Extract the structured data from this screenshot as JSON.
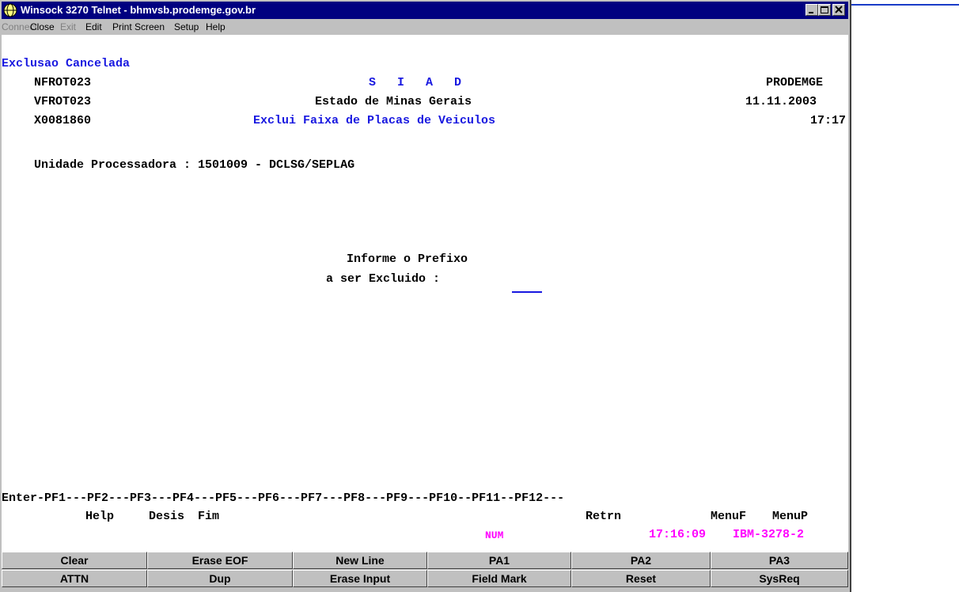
{
  "window": {
    "title": "Winsock 3270 Telnet - bhmvsb.prodemge.gov.br"
  },
  "menu": [
    {
      "label": "Connect",
      "disabled": true
    },
    {
      "label": "Close",
      "disabled": false
    },
    {
      "label": "Exit",
      "disabled": true
    },
    {
      "label": "Edit",
      "disabled": false
    },
    {
      "label": "Print Screen",
      "disabled": false
    },
    {
      "label": "Setup",
      "disabled": false
    },
    {
      "label": "Help",
      "disabled": false
    }
  ],
  "screen": {
    "message": "Exclusao Cancelada",
    "row1_left": "NFROT023",
    "row1_center": "S   I   A   D",
    "row1_right": "PRODEMGE",
    "row2_left": "VFROT023",
    "row2_center": "Estado de Minas Gerais",
    "row2_right": "11.11.2003",
    "row3_left": "X0081860",
    "row3_center": "Exclui Faixa de Placas de Veiculos",
    "row3_right": "17:17",
    "unidade": "Unidade Processadora : 1501009 - DCLSG/SEPLAG",
    "prompt1": "Informe o Prefixo",
    "prompt2": "a ser Excluido :",
    "input_value": "",
    "pf_line": "Enter-PF1---PF2---PF3---PF4---PF5---PF6---PF7---PF8---PF9---PF10--PF11--PF12---",
    "pf_help": "Help",
    "pf_desis": "Desis",
    "pf_fim": "Fim",
    "pf_retrn": "Retrn",
    "pf_menuf": "MenuF",
    "pf_menup": "MenuP",
    "status_num": "NUM",
    "status_time": "17:16:09",
    "status_terminal": "IBM-3278-2"
  },
  "buttons_row1": [
    "Clear",
    "Erase EOF",
    "New Line",
    "PA1",
    "PA2",
    "PA3"
  ],
  "buttons_row2": [
    "ATTN",
    "Dup",
    "Erase Input",
    "Field Mark",
    "Reset",
    "SysReq"
  ],
  "colors": {
    "titlebar": "#000080",
    "field_blue": "#1818e0",
    "status_magenta": "#ff00ff",
    "panel_gray": "#c0c0c0"
  }
}
